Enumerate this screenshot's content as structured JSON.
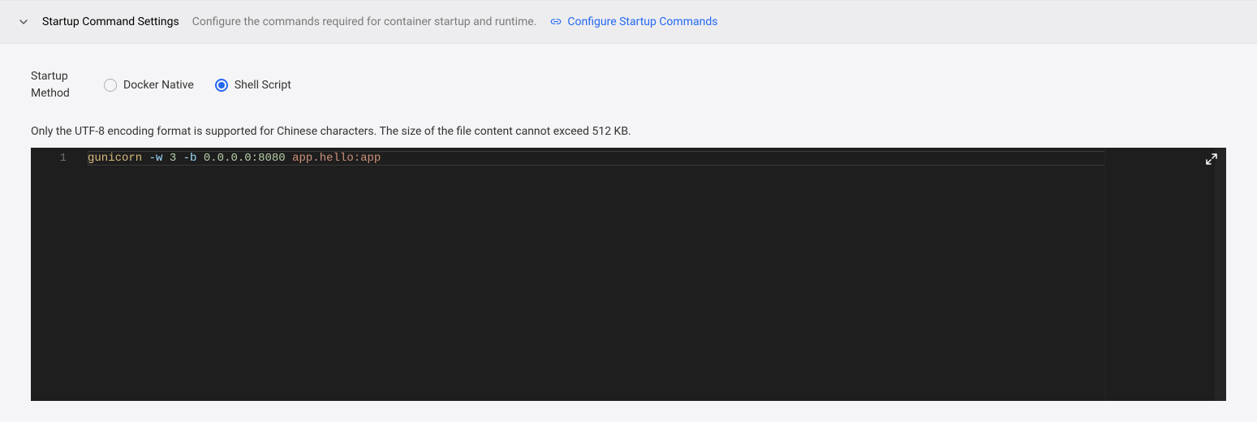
{
  "header": {
    "title": "Startup Command Settings",
    "subtitle": "Configure the commands required for container startup and runtime.",
    "link_label": "Configure Startup Commands"
  },
  "form": {
    "startup_method_label": "Startup Method",
    "radio_docker": "Docker Native",
    "radio_shell": "Shell Script",
    "hint": "Only the UTF-8 encoding format is supported for Chinese characters. The size of the file content cannot exceed 512 KB."
  },
  "editor": {
    "line_number": "1",
    "tokens": {
      "cmd": "gunicorn",
      "flag1": "-w",
      "num1": "3",
      "flag2": "-b",
      "addr": "0.0.0.0:8080",
      "target": "app.hello:app"
    }
  }
}
